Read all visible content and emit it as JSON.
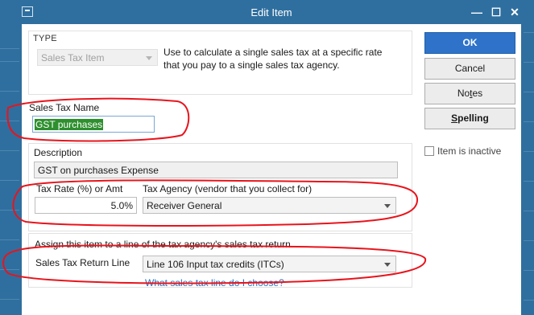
{
  "window": {
    "title": "Edit Item",
    "controls": {
      "minimize": "—",
      "maximize": "☐",
      "close": "✕"
    }
  },
  "type_section": {
    "heading": "TYPE",
    "type_value": "Sales Tax Item",
    "description_line1": "Use to calculate a single sales tax at a specific rate",
    "description_line2": "that you pay to a single sales tax agency."
  },
  "name_section": {
    "label": "Sales Tax Name",
    "value": "GST purchases"
  },
  "description_section": {
    "label": "Description",
    "value": "GST on purchases Expense"
  },
  "rate_section": {
    "rate_label": "Tax Rate (%) or Amt",
    "rate_value": "5.0%",
    "agency_label": "Tax Agency (vendor that you collect for)",
    "agency_value": "Receiver General"
  },
  "return_section": {
    "assign_text": "Assign this item to a line of the tax agency's sales tax return.",
    "line_label": "Sales Tax Return Line",
    "line_value": "Line 106 Input tax credits (ITCs)",
    "help_link": "What sales tax line do I choose?"
  },
  "buttons": {
    "ok": "OK",
    "cancel": "Cancel",
    "notes": "Notes",
    "spelling": "Spelling"
  },
  "inactive": {
    "label": "Item is inactive",
    "checked": false
  },
  "colors": {
    "titlebar": "#2f6f9f",
    "primary_button": "#2e73c9",
    "annotation": "#e8141c",
    "selection": "#2d8f2d",
    "link": "#2a6ebb"
  }
}
